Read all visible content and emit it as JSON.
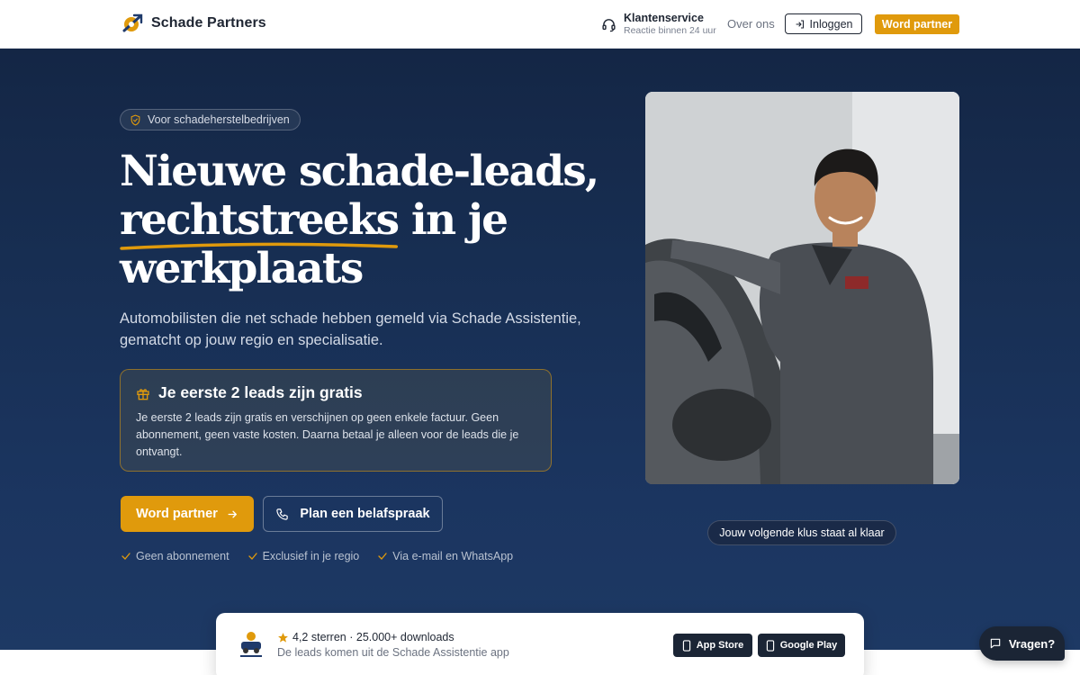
{
  "header": {
    "brand": "Schade Partners",
    "support_title": "Klantenservice",
    "support_sub": "Reactie binnen 24 uur",
    "about_label": "Over ons",
    "login_label": "Inloggen",
    "partner_label": "Word partner"
  },
  "hero": {
    "badge": "Voor schadeherstelbedrijven",
    "headline_line1": "Nieuwe schade-leads,",
    "headline_emph": "rechtstreeks",
    "headline_line2_rest": " in je",
    "headline_line3": "werkplaats",
    "subtitle": "Automobilisten die net schade hebben gemeld via Schade Assistentie, gematcht op jouw regio en specialisatie.",
    "offer_title": "Je eerste 2 leads zijn gratis",
    "offer_body": "Je eerste 2 leads zijn gratis en verschijnen op geen enkele factuur. Geen abonnement, geen vaste kosten. Daarna betaal je alleen voor de leads die je ontvangt.",
    "cta_primary": "Word partner",
    "cta_secondary": "Plan een belafspraak",
    "checks": [
      "Geen abonnement",
      "Exclusief in je regio",
      "Via e-mail en WhatsApp"
    ],
    "photo_caption": "Jouw volgende klus staat al klaar"
  },
  "appbar": {
    "rating": "4,2 sterren · 25.000+ downloads",
    "sub": "De leads komen uit de Schade Assistentie app",
    "app_store": "App Store",
    "google_play": "Google Play"
  },
  "chat": {
    "label": "Vragen?"
  },
  "colors": {
    "accent": "#e09a0c",
    "navy": "#172e52",
    "dark_button": "#1b2535"
  }
}
